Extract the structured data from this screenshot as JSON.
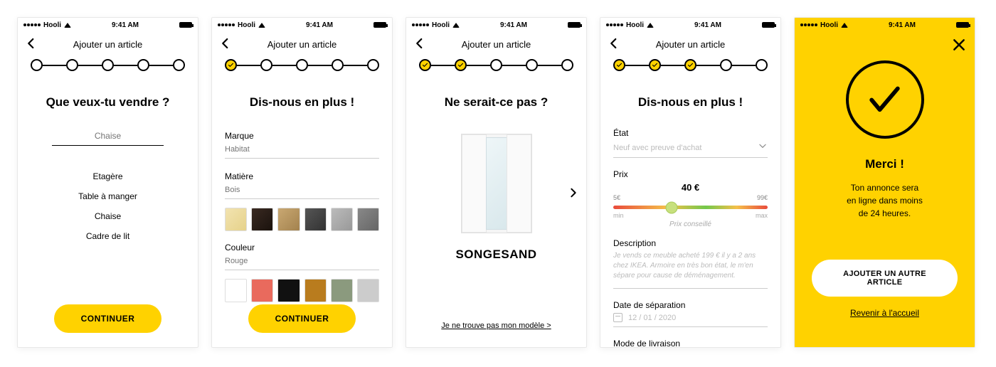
{
  "status": {
    "carrier": "Hooli",
    "time": "9:41 AM"
  },
  "header": {
    "title": "Ajouter un article"
  },
  "screen1": {
    "question": "Que veux-tu vendre ?",
    "input_placeholder": "Chaise",
    "suggestions": [
      "Etagère",
      "Table à manger",
      "Chaise",
      "Cadre de lit"
    ],
    "cta": "CONTINUER"
  },
  "screen2": {
    "question": "Dis-nous en plus !",
    "brand_label": "Marque",
    "brand_placeholder": "Habitat",
    "material_label": "Matière",
    "material_placeholder": "Bois",
    "color_label": "Couleur",
    "color_placeholder": "Rouge",
    "cta": "CONTINUER"
  },
  "screen3": {
    "question": "Ne serait-ce pas ?",
    "product_name": "SONGESAND",
    "not_found": "Je ne trouve pas mon modèle >"
  },
  "screen4": {
    "question": "Dis-nous en plus !",
    "state_label": "État",
    "state_value": "Neuf avec preuve d'achat",
    "price_label": "Prix",
    "price_min": "5€",
    "price_max": "99€",
    "price_value": "40 €",
    "price_value_pct": 38,
    "price_min_label": "min",
    "price_max_label": "max",
    "price_hint": "Prix conseillé",
    "desc_label": "Description",
    "desc_text": "Je vends ce meuble acheté 199 € il y a 2 ans chez IKEA. Armoire en très bon état, le m'en sépare pour cause de déménagement.",
    "date_label": "Date de séparation",
    "date_value": "12 / 01 / 2020",
    "delivery_label": "Mode de livraison"
  },
  "screen5": {
    "title": "Merci !",
    "sub1": "Ton annonce sera",
    "sub2": "en ligne dans moins",
    "sub3": "de 24 heures.",
    "cta": "AJOUTER UN AUTRE ARTICLE",
    "back": "Revenir à l'accueil"
  }
}
